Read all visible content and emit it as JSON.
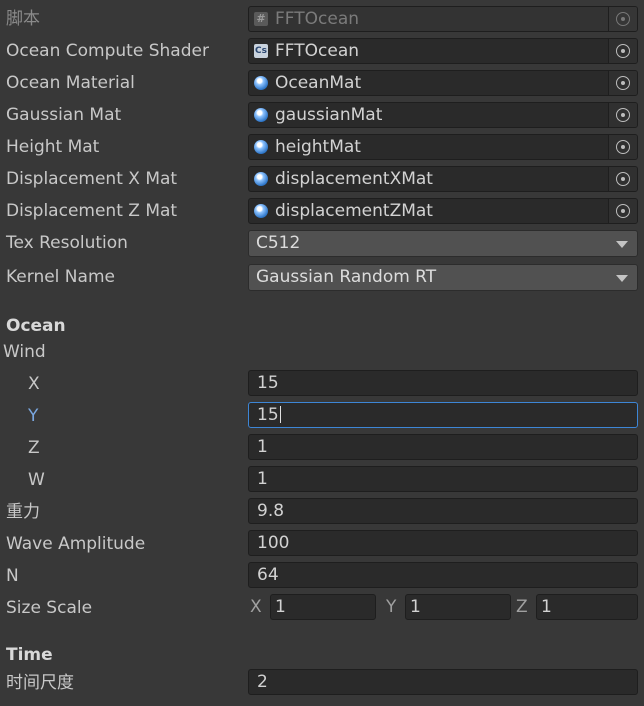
{
  "script_row": {
    "label": "脚本",
    "value": "FFTOcean",
    "icon": "script-icon"
  },
  "objects": [
    {
      "label": "Ocean Compute Shader",
      "value": "FFTOcean",
      "icon": "compute-shader-icon"
    },
    {
      "label": "Ocean Material",
      "value": "OceanMat",
      "icon": "material-icon"
    },
    {
      "label": "Gaussian Mat",
      "value": "gaussianMat",
      "icon": "material-icon"
    },
    {
      "label": "Height Mat",
      "value": "heightMat",
      "icon": "material-icon"
    },
    {
      "label": "Displacement X Mat",
      "value": "displacementXMat",
      "icon": "material-icon"
    },
    {
      "label": "Displacement Z Mat",
      "value": "displacementZMat",
      "icon": "material-icon"
    }
  ],
  "tex_resolution": {
    "label": "Tex Resolution",
    "value": "C512"
  },
  "kernel_name": {
    "label": "Kernel Name",
    "value": "Gaussian Random RT"
  },
  "ocean_header": "Ocean",
  "wind": {
    "label": "Wind",
    "x_label": "X",
    "x": "15",
    "y_label": "Y",
    "y": "15",
    "z_label": "Z",
    "z": "1",
    "w_label": "W",
    "w": "1"
  },
  "gravity": {
    "label": "重力",
    "value": "9.8"
  },
  "wave_amplitude": {
    "label": "Wave Amplitude",
    "value": "100"
  },
  "n": {
    "label": "N",
    "value": "64"
  },
  "size_scale": {
    "label": "Size Scale",
    "x_label": "X",
    "x": "1",
    "y_label": "Y",
    "y": "1",
    "z_label": "Z",
    "z": "1"
  },
  "time_header": "Time",
  "time_scale": {
    "label": "时间尺度",
    "value": "2"
  },
  "colors": {
    "background": "#383838",
    "field": "#2a2a2a",
    "focus": "#3d86d6",
    "active_label": "#7aa7e0"
  }
}
